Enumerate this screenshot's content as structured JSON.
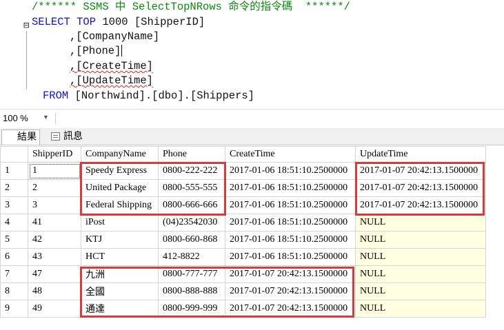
{
  "editor": {
    "comment_line": "/****** SSMS 中 SelectTopNRows 命令的指令碼  ******/",
    "select_keyword": "SELECT",
    "top_keyword": "TOP",
    "top_count": "1000",
    "first_column": "[ShipperID]",
    "columns": [
      ",[CompanyName]",
      ",[Phone]",
      ",[CreateTime]",
      ",[UpdateTime]"
    ],
    "from_keyword": "FROM",
    "from_target": "[Northwind].[dbo].[Shippers]"
  },
  "zoom": {
    "level": "100 %"
  },
  "tabs": [
    {
      "label": "結果",
      "icon": "grid-icon",
      "active": true
    },
    {
      "label": "訊息",
      "icon": "message-icon",
      "active": false
    }
  ],
  "results": {
    "columns": [
      "ShipperID",
      "CompanyName",
      "Phone",
      "CreateTime",
      "UpdateTime"
    ],
    "rows": [
      {
        "n": "1",
        "ShipperID": "1",
        "CompanyName": "Speedy Express",
        "Phone": "0800-222-222",
        "CreateTime": "2017-01-06 18:51:10.2500000",
        "UpdateTime": "2017-01-07 20:42:13.1500000"
      },
      {
        "n": "2",
        "ShipperID": "2",
        "CompanyName": "United Package",
        "Phone": "0800-555-555",
        "CreateTime": "2017-01-06 18:51:10.2500000",
        "UpdateTime": "2017-01-07 20:42:13.1500000"
      },
      {
        "n": "3",
        "ShipperID": "3",
        "CompanyName": "Federal Shipping",
        "Phone": "0800-666-666",
        "CreateTime": "2017-01-06 18:51:10.2500000",
        "UpdateTime": "2017-01-07 20:42:13.1500000"
      },
      {
        "n": "4",
        "ShipperID": "41",
        "CompanyName": "iPost",
        "Phone": "(04)23542030",
        "CreateTime": "2017-01-06 18:51:10.2500000",
        "UpdateTime": "NULL"
      },
      {
        "n": "5",
        "ShipperID": "42",
        "CompanyName": "KTJ",
        "Phone": "0800-660-868",
        "CreateTime": "2017-01-06 18:51:10.2500000",
        "UpdateTime": "NULL"
      },
      {
        "n": "6",
        "ShipperID": "43",
        "CompanyName": "HCT",
        "Phone": "412-8822",
        "CreateTime": "2017-01-06 18:51:10.2500000",
        "UpdateTime": "NULL"
      },
      {
        "n": "7",
        "ShipperID": "47",
        "CompanyName": "九洲",
        "Phone": "0800-777-777",
        "CreateTime": "2017-01-07 20:42:13.1500000",
        "UpdateTime": "NULL"
      },
      {
        "n": "8",
        "ShipperID": "48",
        "CompanyName": "全國",
        "Phone": "0800-888-888",
        "CreateTime": "2017-01-07 20:42:13.1500000",
        "UpdateTime": "NULL"
      },
      {
        "n": "9",
        "ShipperID": "49",
        "CompanyName": "通達",
        "Phone": "0800-999-999",
        "CreateTime": "2017-01-07 20:42:13.1500000",
        "UpdateTime": "NULL"
      }
    ]
  },
  "colors": {
    "keyword": "#1010e0",
    "comment": "#0a8a0a",
    "highlight_border": "#d63a3a",
    "null_cell": "#ffffe1"
  }
}
